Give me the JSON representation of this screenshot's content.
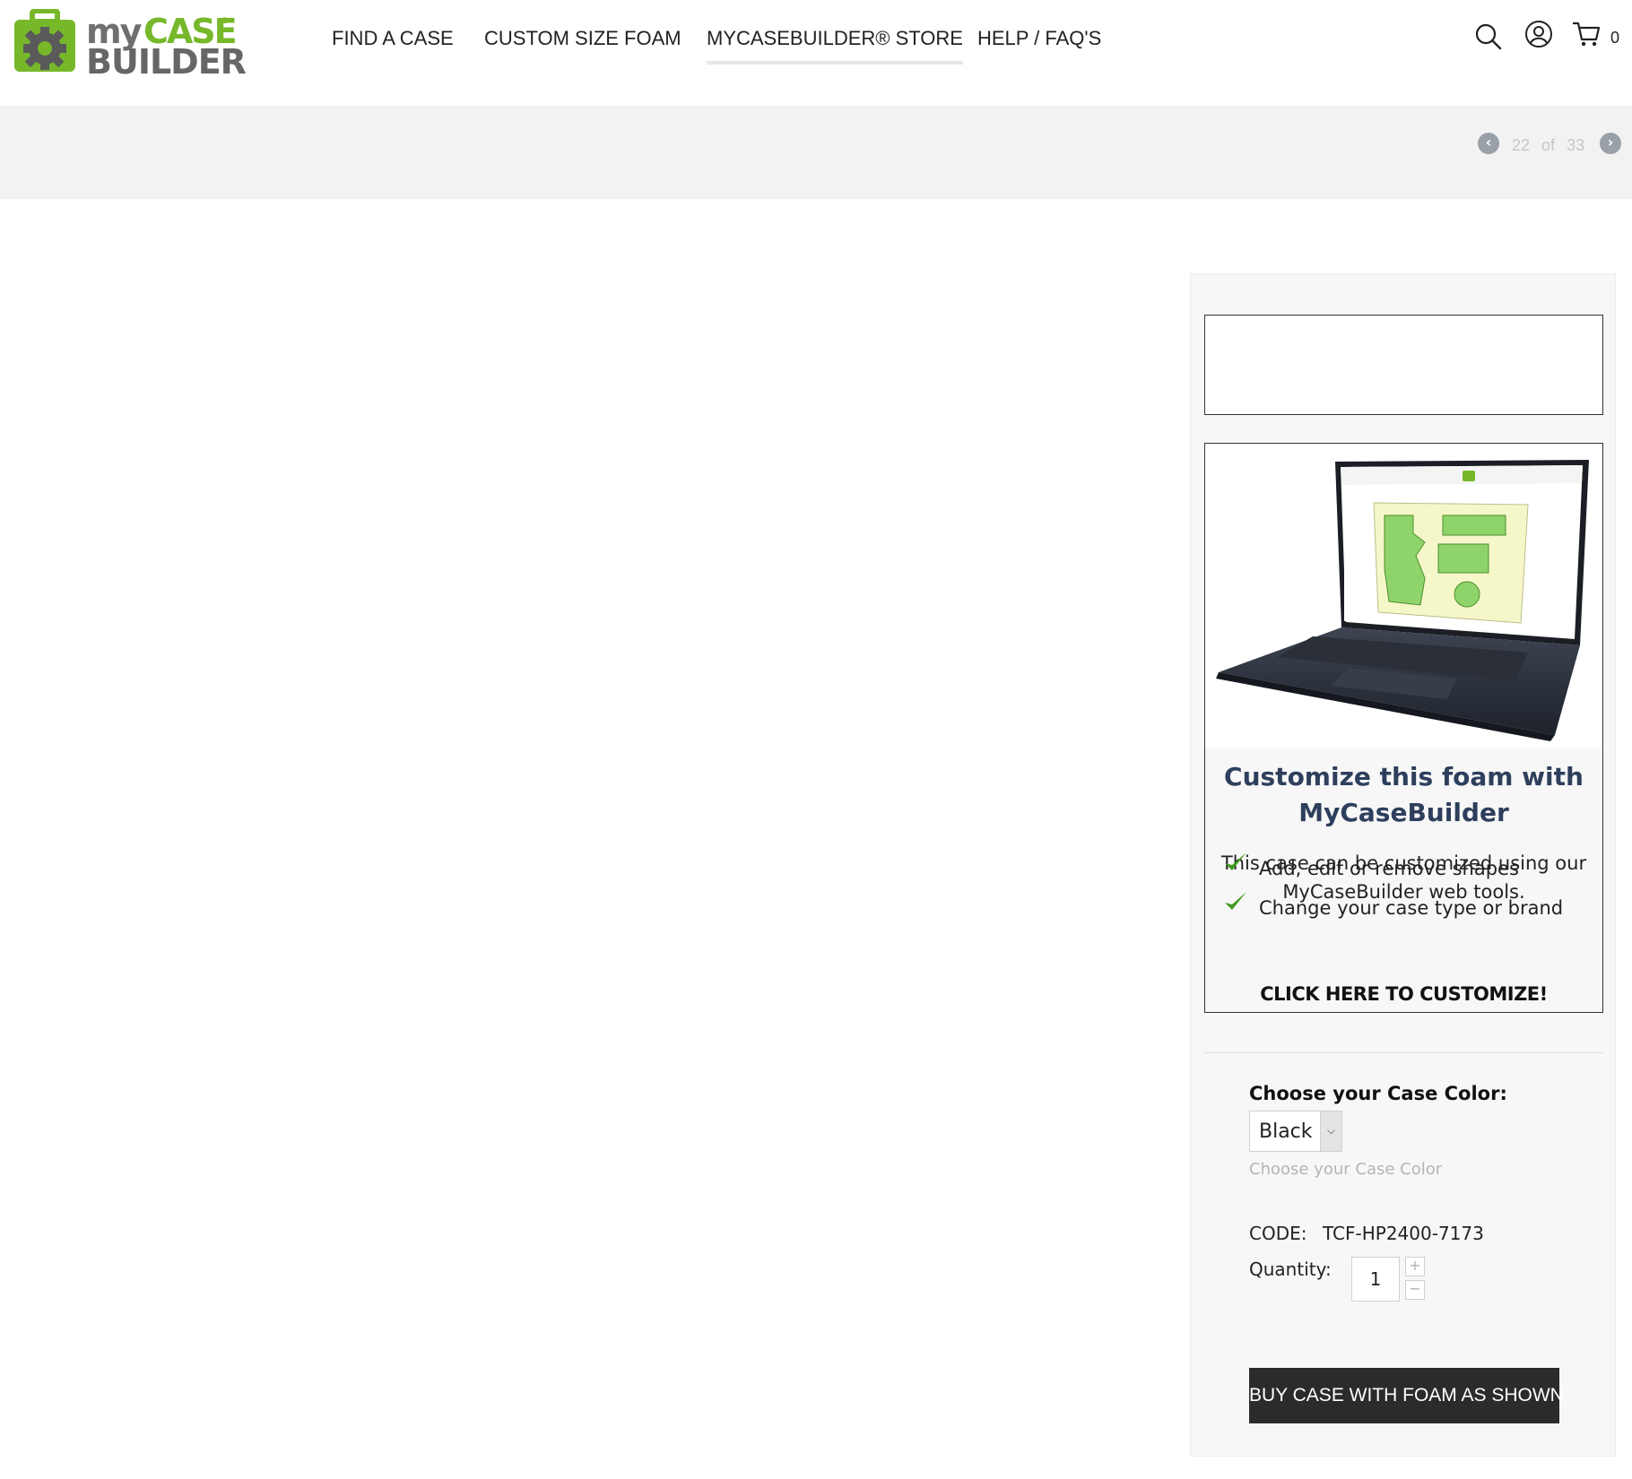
{
  "brand": {
    "logo_my": "my",
    "logo_case": "CASE",
    "logo_builder": "BUILDER",
    "logo_reg": "®"
  },
  "nav": {
    "items": [
      {
        "label": "FIND A CASE"
      },
      {
        "label": "CUSTOM SIZE FOAM"
      },
      {
        "label": "MYCASEBUILDER® STORE",
        "active": true
      },
      {
        "label": "HELP / FAQ'S"
      }
    ]
  },
  "header_icons": {
    "search": "search-icon",
    "account": "user-icon",
    "cart": "cart-icon",
    "cart_count": "0"
  },
  "pager": {
    "current": "22",
    "of": "of",
    "total": "33",
    "prev_icon": "chevron-left-icon",
    "next_icon": "chevron-right-icon"
  },
  "promo": {
    "title": "Customize this foam with MyCaseBuilder",
    "description": "This case can be customized using our MyCaseBuilder web tools.",
    "bullets": [
      "Add, edit or remove shapes",
      "Change your case type or brand"
    ],
    "cta": "CLICK HERE TO CUSTOMIZE!"
  },
  "options": {
    "color_label": "Choose your Case Color:",
    "color_value": "Black",
    "color_help": "Choose your Case Color"
  },
  "product": {
    "code_label": "CODE:",
    "code": "TCF-HP2400-7173",
    "quantity_label": "Quantity:",
    "quantity": "1",
    "buy_label": "BUY CASE WITH FOAM AS SHOWN"
  },
  "colors": {
    "brand_green": "#76b82a",
    "brand_grey": "#666666",
    "title_navy": "#2d3f5c",
    "buy_button": "#2b2b2b",
    "banner": "#f2f2f2"
  }
}
